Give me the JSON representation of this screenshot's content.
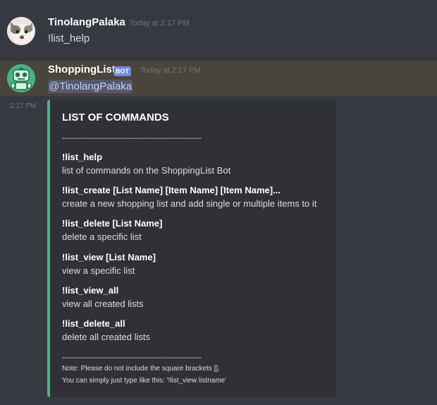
{
  "messages": [
    {
      "username": "TinolangPalaka",
      "timestamp": "Today at 2:17 PM",
      "content": "!list_help",
      "avatar_icon": "cat-avatar-icon"
    },
    {
      "username": "ShoppingList",
      "bot_tag": "BOT",
      "timestamp": "Today at 2:17 PM",
      "mention": "@TinolangPalaka",
      "avatar_icon": "robot-avatar-icon",
      "side_time": "2:17 PM"
    }
  ],
  "embed": {
    "accent_color": "#43b581",
    "title": "LIST OF COMMANDS",
    "divider_top": "------------------------------------------------------",
    "commands": [
      {
        "name": "!list_help",
        "description": "list of commands on the ShoppingList Bot"
      },
      {
        "name": "!list_create [List Name] [Item Name] [Item Name]...",
        "description": "create a new shopping list and add single or multiple items to it"
      },
      {
        "name": "!list_delete [List Name]",
        "description": "delete a specific list"
      },
      {
        "name": "!list_view [List Name]",
        "description": "view a specific list"
      },
      {
        "name": "!list_view_all",
        "description": "view all created lists"
      },
      {
        "name": "!list_delete_all",
        "description": "delete all created lists"
      }
    ],
    "divider_bottom": "------------------------------------------------------",
    "note_line1": "Note: Please do not include the square brackets [].",
    "note_line2": "You can simply just type like this: '!list_view listname'"
  }
}
